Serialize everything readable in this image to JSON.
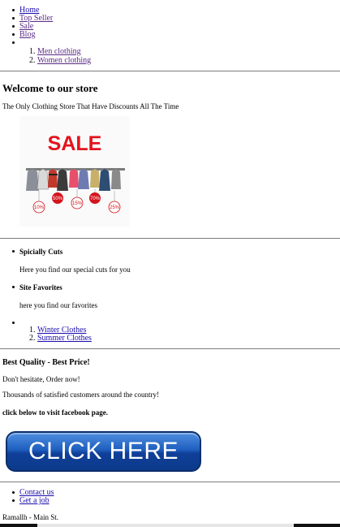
{
  "nav": {
    "items": [
      {
        "label": "Home"
      },
      {
        "label": "Top Seller"
      },
      {
        "label": "Sale"
      },
      {
        "label": "Blog"
      }
    ],
    "sub_items": [
      {
        "label": "Men clothing"
      },
      {
        "label": "Women clothing"
      }
    ]
  },
  "hero": {
    "title": "Welcome to our store",
    "tagline": "The Only Clothing Store That Have Discounts All The Time",
    "sale_banner": {
      "heading": "SALE",
      "tags": [
        "10%",
        "50%",
        "15%",
        "70%",
        "25%"
      ],
      "colors": {
        "heading": "#e3141d",
        "tag_red": "#d4141c"
      }
    }
  },
  "sections": {
    "items": [
      {
        "title": "Spicially Cuts",
        "desc": "Here you find our special cuts for you"
      },
      {
        "title": "Site Favorites",
        "desc": "here you find our favorites"
      }
    ],
    "sub_items": [
      {
        "label": "Winter Clothes"
      },
      {
        "label": "Summer Clothes"
      }
    ]
  },
  "promo": {
    "title": "Best Quality - Best Price!",
    "line1": "Don't hesitate, Order now!",
    "line2": "Thousands of satisfied customers around the country!",
    "facebook_note": "click below to visit facebook page.",
    "cta_label": "CLICK HERE",
    "cta_colors": {
      "top": "#4f8fe0",
      "bottom": "#0c3a8a"
    }
  },
  "footer": {
    "links": [
      {
        "label": "Contact us"
      },
      {
        "label": "Get a job"
      }
    ],
    "address": "Ramallh - Main St."
  }
}
